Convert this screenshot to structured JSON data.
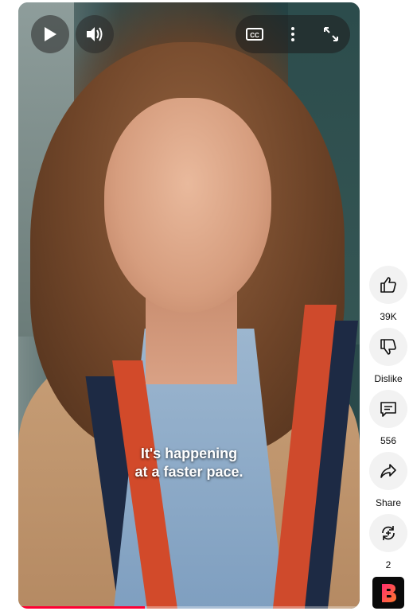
{
  "player": {
    "caption_line1": "It's happening",
    "caption_line2": "at a faster pace.",
    "progress_fraction": 0.37,
    "icons": [
      "play-icon",
      "volume-icon",
      "closed-captions-icon",
      "more-vert-icon",
      "fullscreen-icon"
    ],
    "cc_label": "CC"
  },
  "actions": {
    "like_count": "39K",
    "dislike_label": "Dislike",
    "comment_count": "556",
    "share_label": "Share",
    "remix_count": "2"
  },
  "colors": {
    "progress": "#ff0033",
    "action_bg": "#f2f2f2"
  }
}
